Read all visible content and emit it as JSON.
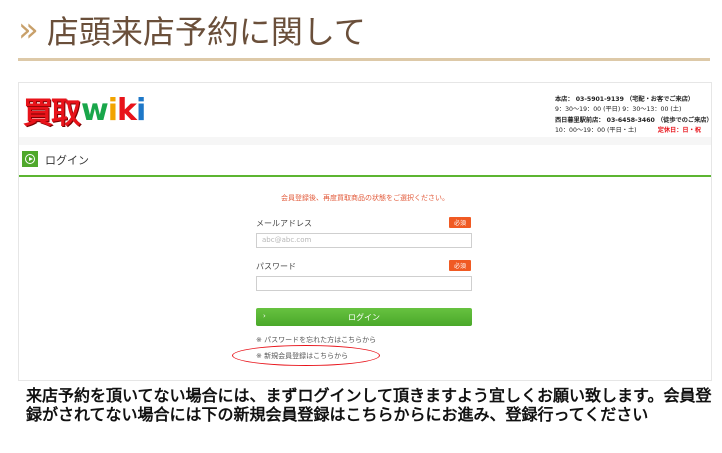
{
  "heading": {
    "chevrons": "»",
    "title": "店頭来店予約に関して"
  },
  "site": {
    "logo_kanji": "買取",
    "logo_latin": [
      "w",
      "i",
      "k",
      "i"
    ],
    "store": {
      "main_line1": "本店： 03-5901-9139 （宅配・お客でご来店）",
      "main_line2": "9：30〜19：00 (平日) 9：30〜13：00 (土)",
      "branch_line1": "西日暮里駅前店： 03-6458-3460 （徒歩でのご来店）",
      "branch_line2": "10：00〜19：00 (平日・土)",
      "closed": "定休日：日・祝"
    }
  },
  "login_panel": {
    "title": "ログイン",
    "notice": "会員登録後、再度買取商品の状態をご選択ください。",
    "email_label": "メールアドレス",
    "email_placeholder": "abc@abc.com",
    "password_label": "パスワード",
    "required_badge": "必須",
    "login_button": "ログイン",
    "login_button_arrow": "›",
    "forgot_link": "※ パスワードを忘れた方はこちらから",
    "register_link": "※ 新規会員登録はこちらから"
  },
  "caption": "来店予約を頂いてない場合には、まずログインして頂きますよう宜しくお願い致します。会員登録がされてない場合には下の新規会員登録はこちらからにお進み、登録行ってください",
  "colors": {
    "accent_green": "#4fa82b",
    "badge_orange": "#f05a23",
    "highlight_red": "#e8131a",
    "heading_brown": "#6a4f3a"
  }
}
